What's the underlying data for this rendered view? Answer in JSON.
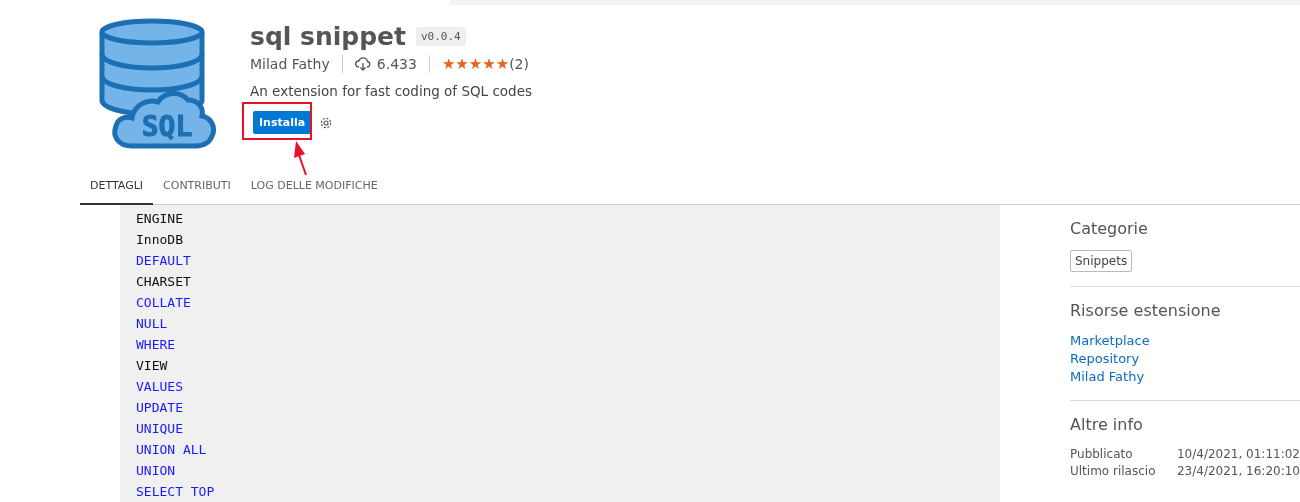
{
  "extension": {
    "logo_text": "SQL",
    "name": "sql snippet",
    "version": "v0.0.4",
    "publisher": "Milad Fathy",
    "downloads": "6.433",
    "stars": 5,
    "rating_count": "(2)",
    "description": "An extension for fast coding of SQL codes",
    "install_button": "Installa",
    "highlighted": true
  },
  "tabs": [
    {
      "label": "DETTAGLI",
      "selected": true
    },
    {
      "label": "CONTRIBUTI",
      "selected": false
    },
    {
      "label": "LOG DELLE MODIFICHE",
      "selected": false
    }
  ],
  "code_lines": [
    {
      "text": "ENGINE",
      "keyword": false
    },
    {
      "text": "InnoDB",
      "keyword": false
    },
    {
      "text": "DEFAULT",
      "keyword": true
    },
    {
      "text": "CHARSET",
      "keyword": false
    },
    {
      "text": "COLLATE",
      "keyword": true
    },
    {
      "text": "NULL",
      "keyword": true
    },
    {
      "text": "WHERE",
      "keyword": true
    },
    {
      "text": "VIEW",
      "keyword": false
    },
    {
      "text": "VALUES",
      "keyword": true
    },
    {
      "text": "UPDATE",
      "keyword": true
    },
    {
      "text": "UNIQUE",
      "keyword": true
    },
    {
      "text": "UNION ALL",
      "keyword": true
    },
    {
      "text": "UNION",
      "keyword": true
    },
    {
      "text": "SELECT TOP",
      "keyword": true
    }
  ],
  "sidebar": {
    "categories_title": "Categorie",
    "categories": [
      "Snippets"
    ],
    "resources_title": "Risorse estensione",
    "resources": [
      "Marketplace",
      "Repository",
      "Milad Fathy"
    ],
    "info_title": "Altre info",
    "info": [
      {
        "label": "Pubblicato",
        "value": "10/4/2021, 01:11:02"
      },
      {
        "label": "Ultimo rilascio",
        "value": "23/4/2021, 16:20:10"
      }
    ]
  }
}
